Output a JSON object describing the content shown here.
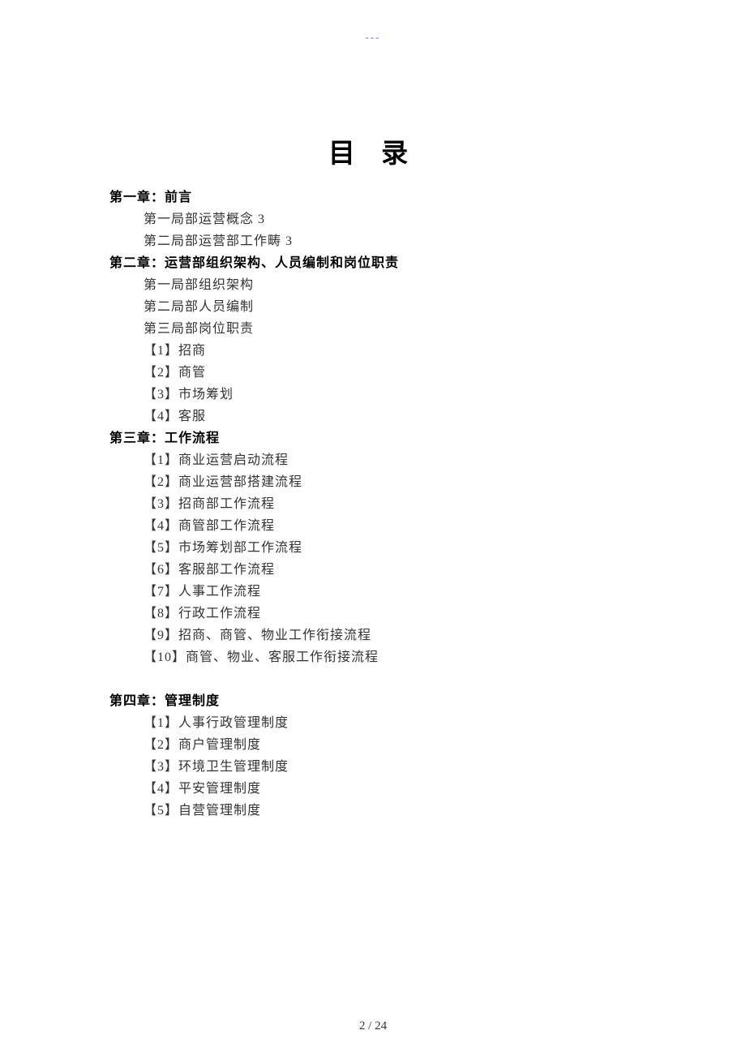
{
  "header_mark": "---",
  "title": "目 录",
  "chapters": [
    {
      "heading": "第一章：前言",
      "items": [
        "第一局部运营概念 3",
        "第二局部运营部工作畴 3"
      ]
    },
    {
      "heading": "第二章：运营部组织架构、人员编制和岗位职责",
      "items": [
        "第一局部组织架构",
        "第二局部人员编制",
        "第三局部岗位职责",
        "【1】招商",
        "【2】商管",
        "【3】市场筹划",
        "【4】客服"
      ]
    },
    {
      "heading": "第三章：工作流程",
      "items": [
        "【1】商业运营启动流程",
        "【2】商业运营部搭建流程",
        "【3】招商部工作流程",
        "【4】商管部工作流程",
        "【5】市场筹划部工作流程",
        "【6】客服部工作流程",
        "【7】人事工作流程",
        "【8】行政工作流程",
        "【9】招商、商管、物业工作衔接流程",
        "【10】商管、物业、客服工作衔接流程"
      ]
    },
    {
      "heading": "第四章：管理制度",
      "spacer_before": true,
      "items": [
        "【1】人事行政管理制度",
        "【2】商户管理制度",
        "【3】环境卫生管理制度",
        "【4】平安管理制度",
        "【5】自营管理制度"
      ]
    }
  ],
  "page_number": "2 / 24"
}
